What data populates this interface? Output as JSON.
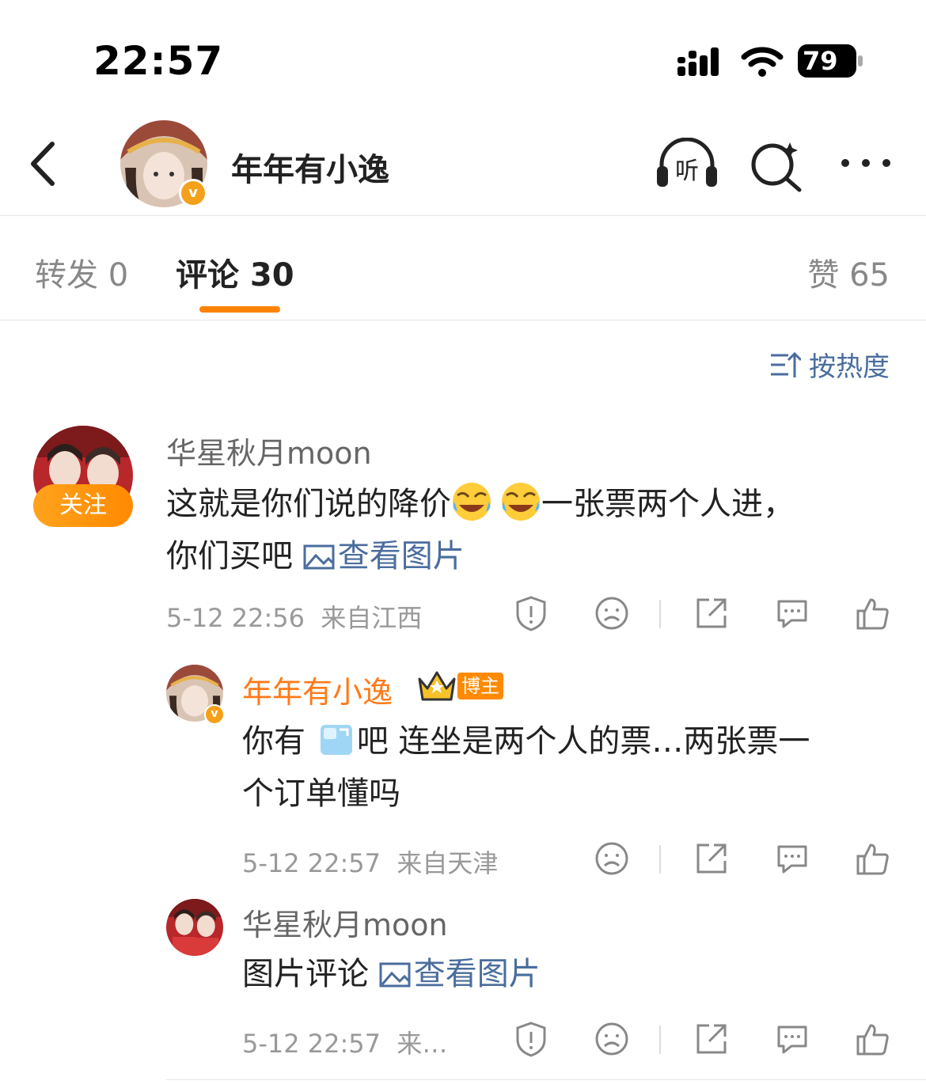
{
  "status_bar": {
    "time": "22:57",
    "battery": "79"
  },
  "header": {
    "title": "年年有小逸",
    "listen_label": "听",
    "verified_mark": "v"
  },
  "tabs": {
    "repost": "转发 0",
    "comment": "评论 30",
    "like": "赞 65"
  },
  "sort": {
    "label": "按热度"
  },
  "comments": [
    {
      "username": "华星秋月moon",
      "follow_label": "关注",
      "text_before": "这就是你们说的降价",
      "text_after": "一张票两个人进，",
      "text_line2": "你们买吧",
      "link": "查看图片",
      "time": "5-12 22:56",
      "location": "来自江西"
    },
    {
      "username": "年年有小逸",
      "tag": "博主",
      "text_a": "你有",
      "text_b": "吧 连坐是两个人的票…两张票一",
      "text_line2": "个订单懂吗",
      "time": "5-12 22:57",
      "location": "来自天津"
    },
    {
      "username": "华星秋月moon",
      "text": "图片评论",
      "link": "查看图片",
      "time": "5-12 22:57",
      "location": "来…"
    }
  ],
  "colors": {
    "accent": "#ff8200",
    "link": "#4a6d9e",
    "host_name": "#ff7a1a"
  },
  "icons": [
    "back-icon",
    "listen-icon",
    "search-icon",
    "more-icon",
    "sort-icon",
    "report-icon",
    "dislike-icon",
    "share-icon",
    "reply-icon",
    "like-icon",
    "picture-icon"
  ]
}
